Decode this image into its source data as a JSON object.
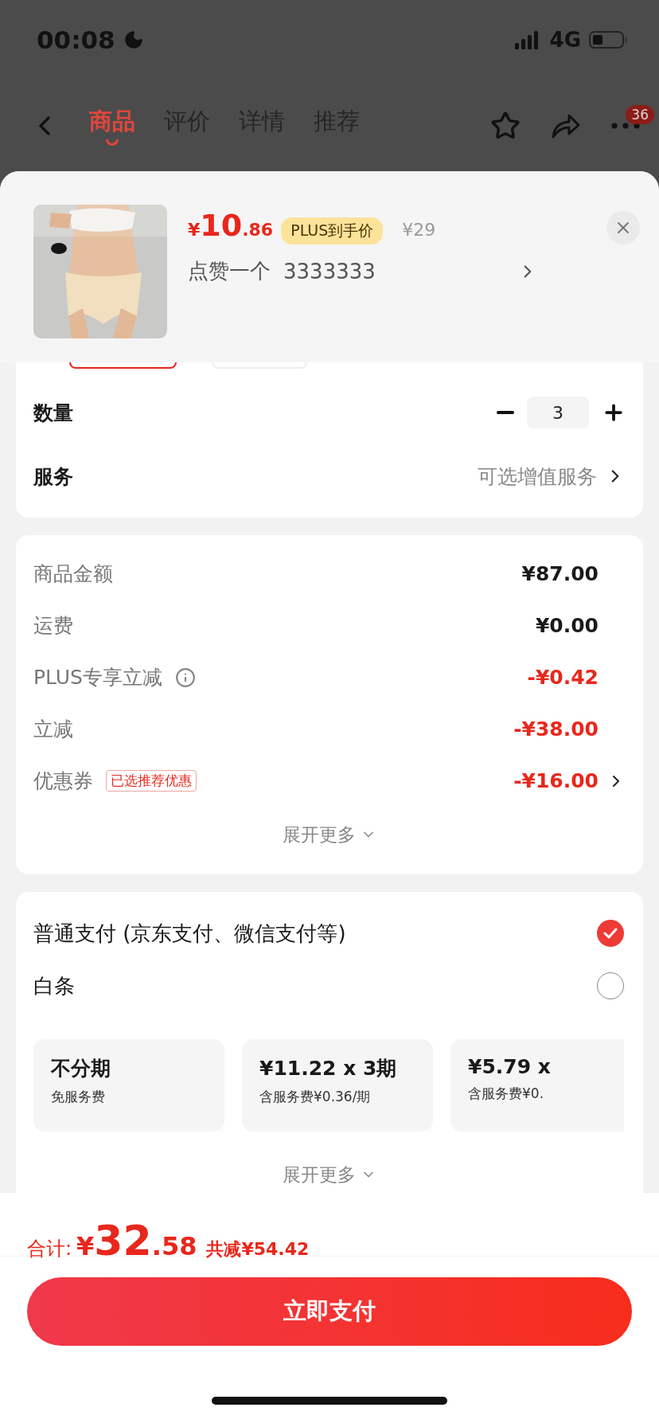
{
  "status_bar": {
    "time": "00:08",
    "network": "4G"
  },
  "nav": {
    "tabs": [
      {
        "label": "商品",
        "selected": true
      },
      {
        "label": "评价",
        "selected": false
      },
      {
        "label": "详情",
        "selected": false
      },
      {
        "label": "推荐",
        "selected": false
      }
    ],
    "more_badge": "36"
  },
  "product": {
    "currency": "¥",
    "price_int": "10",
    "price_dec": ".86",
    "plus_tag": "PLUS到手价",
    "original_price": "¥29",
    "spec_name": "点赞一个",
    "spec_value": "3333333"
  },
  "quantity": {
    "label": "数量",
    "value": "3"
  },
  "service": {
    "label": "服务",
    "value": "可选增值服务"
  },
  "price_rows": [
    {
      "label": "商品金额",
      "value": "¥87.00",
      "negative": false,
      "info": false,
      "arrow": false
    },
    {
      "label": "运费",
      "value": "¥0.00",
      "negative": false,
      "info": false,
      "arrow": false
    },
    {
      "label": "PLUS专享立减",
      "value": "-¥0.42",
      "negative": true,
      "info": true,
      "arrow": false
    },
    {
      "label": "立减",
      "value": "-¥38.00",
      "negative": true,
      "info": false,
      "arrow": false
    },
    {
      "label": "优惠券",
      "tag": "已选推荐优惠",
      "value": "-¥16.00",
      "negative": true,
      "info": false,
      "arrow": true
    }
  ],
  "price_expand": "展开更多",
  "payment": {
    "options": [
      {
        "label": "普通支付 (京东支付、微信支付等)",
        "selected": true
      },
      {
        "label": "白条",
        "selected": false
      }
    ],
    "installments": [
      {
        "title": "不分期",
        "note": "免服务费"
      },
      {
        "title": "¥11.22 x 3期",
        "note": "含服务费¥0.36/期"
      },
      {
        "title": "¥5.79 x",
        "note": "含服务费¥0."
      }
    ],
    "expand": "展开更多"
  },
  "footer": {
    "total_label": "合计:",
    "currency": "¥",
    "total_int": "32",
    "total_dec": ".58",
    "saving": "共减¥54.42",
    "pay_button": "立即支付"
  }
}
